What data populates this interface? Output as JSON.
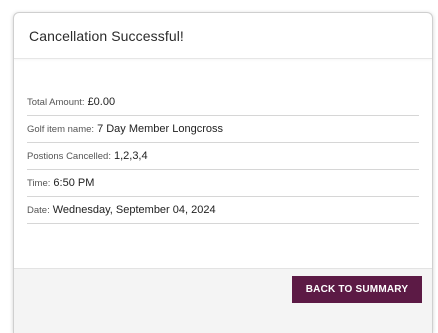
{
  "dialog": {
    "title": "Cancellation Successful!"
  },
  "details": [
    {
      "label": "Total Amount:",
      "value": "£0.00"
    },
    {
      "label": "Golf item name:",
      "value": "7 Day Member Longcross"
    },
    {
      "label": "Postions Cancelled:",
      "value": "1,2,3,4"
    },
    {
      "label": "Time:",
      "value": "6:50 PM"
    },
    {
      "label": "Date:",
      "value": "Wednesday, September 04, 2024"
    }
  ],
  "footer": {
    "back_label": "BACK TO SUMMARY"
  },
  "colors": {
    "button_bg": "#5c1a45",
    "button_text": "#ffffff"
  }
}
